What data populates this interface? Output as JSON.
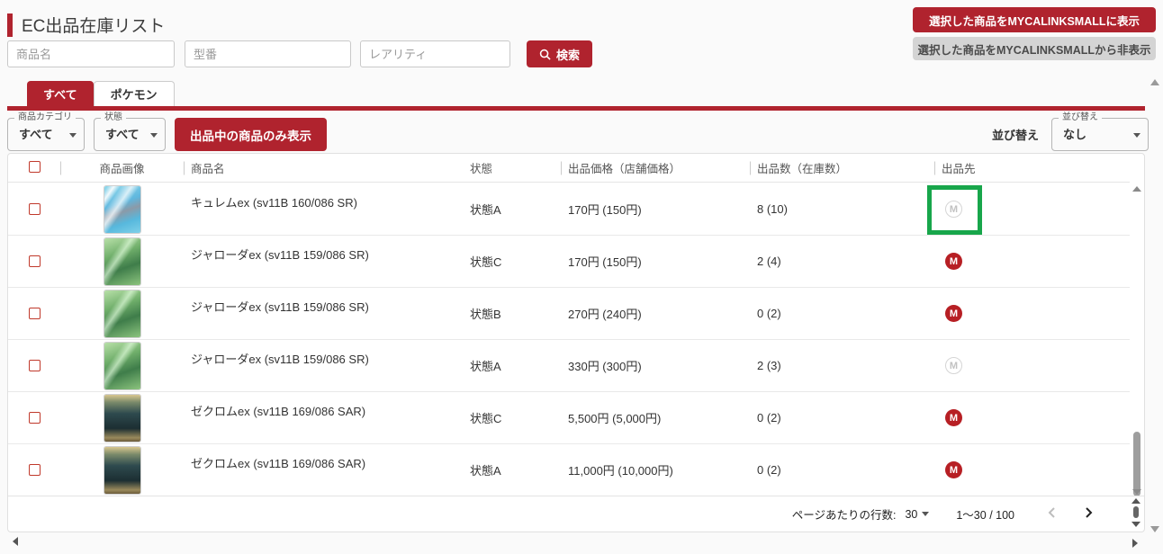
{
  "page": {
    "title": "EC出品在庫リスト"
  },
  "search": {
    "name_placeholder": "商品名",
    "model_placeholder": "型番",
    "rarity_placeholder": "レアリティ",
    "search_button": "検索"
  },
  "actions": {
    "show_button": "選択した商品をMYCALINKSMALLに表示",
    "hide_button": "選択した商品をMYCALINKSMALLから非表示"
  },
  "tabs": {
    "all": "すべて",
    "pokemon": "ポケモン"
  },
  "filters": {
    "category_label": "商品カテゴリ",
    "category_value": "すべて",
    "status_label": "状態",
    "status_value": "すべて",
    "listing_only_button": "出品中の商品のみ表示",
    "sort_label": "並び替え",
    "sort_select_label": "並び替え",
    "sort_value": "なし"
  },
  "table": {
    "headers": {
      "image": "商品画像",
      "name": "商品名",
      "condition": "状態",
      "price": "出品価格（店舗価格）",
      "quantity": "出品数（在庫数）",
      "destination": "出品先"
    },
    "badge_letter": "M",
    "rows": [
      {
        "name": "キュレムex (sv11B 160/086 SR)",
        "condition": "状態A",
        "price": "170円 (150円)",
        "quantity": "8 (10)",
        "destination_active": false,
        "art": "kyurem"
      },
      {
        "name": "ジャローダex (sv11B 159/086 SR)",
        "condition": "状態C",
        "price": "170円 (150円)",
        "quantity": "2 (4)",
        "destination_active": true,
        "art": "serperior"
      },
      {
        "name": "ジャローダex (sv11B 159/086 SR)",
        "condition": "状態B",
        "price": "270円 (240円)",
        "quantity": "0 (2)",
        "destination_active": true,
        "art": "serperior"
      },
      {
        "name": "ジャローダex (sv11B 159/086 SR)",
        "condition": "状態A",
        "price": "330円 (300円)",
        "quantity": "2 (3)",
        "destination_active": false,
        "art": "serperior"
      },
      {
        "name": "ゼクロムex (sv11B 169/086 SAR)",
        "condition": "状態C",
        "price": "5,500円 (5,000円)",
        "quantity": "0 (2)",
        "destination_active": true,
        "art": "zekrom"
      },
      {
        "name": "ゼクロムex (sv11B 169/086 SAR)",
        "condition": "状態A",
        "price": "11,000円 (10,000円)",
        "quantity": "0 (2)",
        "destination_active": true,
        "art": "zekrom"
      }
    ]
  },
  "pagination": {
    "rows_per_page_label": "ページあたりの行数:",
    "rows_per_page_value": "30",
    "range": "1～30 / 100"
  },
  "colors": {
    "accent_red": "#b0232e",
    "badge_red": "#b71f24",
    "annotation_green": "#18a64b"
  }
}
